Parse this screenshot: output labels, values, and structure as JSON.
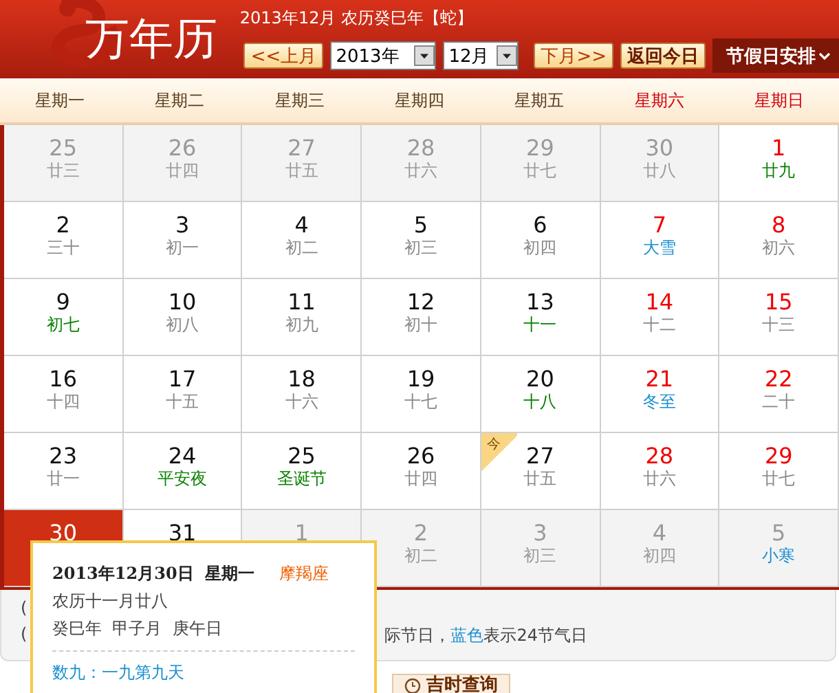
{
  "header": {
    "title": "万年历",
    "subtitle": "2013年12月 农历癸巳年【蛇】",
    "prev_button": "<<上月",
    "year_select": "2013年",
    "month_select": "12月",
    "next_button": "下月>>",
    "today_button": "返回今日",
    "holiday_menu": "节假日安排"
  },
  "weekdays": [
    {
      "label": "星期一",
      "weekend": false
    },
    {
      "label": "星期二",
      "weekend": false
    },
    {
      "label": "星期三",
      "weekend": false
    },
    {
      "label": "星期四",
      "weekend": false
    },
    {
      "label": "星期五",
      "weekend": false
    },
    {
      "label": "星期六",
      "weekend": true
    },
    {
      "label": "星期日",
      "weekend": true
    }
  ],
  "days": [
    {
      "day": "25",
      "sub": "廿三",
      "kind": "other",
      "color": "#999999",
      "selected": false
    },
    {
      "day": "26",
      "sub": "廿四",
      "kind": "other",
      "color": "#999999",
      "selected": false
    },
    {
      "day": "27",
      "sub": "廿五",
      "kind": "other",
      "color": "#999999",
      "selected": false
    },
    {
      "day": "28",
      "sub": "廿六",
      "kind": "other",
      "color": "#999999",
      "selected": false
    },
    {
      "day": "29",
      "sub": "廿七",
      "kind": "other",
      "color": "#999999",
      "selected": false
    },
    {
      "day": "30",
      "sub": "廿八",
      "kind": "other",
      "color": "#999999",
      "selected": false
    },
    {
      "day": "1",
      "sub": "廿九",
      "kind": "current",
      "color": "#098000",
      "weekend": true,
      "selected": false
    },
    {
      "day": "2",
      "sub": "三十",
      "kind": "current",
      "color": "#888888",
      "weekend": false,
      "selected": false
    },
    {
      "day": "3",
      "sub": "初一",
      "kind": "current",
      "color": "#888888",
      "weekend": false,
      "selected": false
    },
    {
      "day": "4",
      "sub": "初二",
      "kind": "current",
      "color": "#888888",
      "weekend": false,
      "selected": false
    },
    {
      "day": "5",
      "sub": "初三",
      "kind": "current",
      "color": "#888888",
      "weekend": false,
      "selected": false
    },
    {
      "day": "6",
      "sub": "初四",
      "kind": "current",
      "color": "#888888",
      "weekend": false,
      "selected": false
    },
    {
      "day": "7",
      "sub": "大雪",
      "kind": "current",
      "color": "#1a8fd0",
      "weekend": true,
      "selected": false
    },
    {
      "day": "8",
      "sub": "初六",
      "kind": "current",
      "color": "#888888",
      "weekend": true,
      "selected": false
    },
    {
      "day": "9",
      "sub": "初七",
      "kind": "current",
      "color": "#098000",
      "weekend": false,
      "selected": false
    },
    {
      "day": "10",
      "sub": "初八",
      "kind": "current",
      "color": "#888888",
      "weekend": false,
      "selected": false
    },
    {
      "day": "11",
      "sub": "初九",
      "kind": "current",
      "color": "#888888",
      "weekend": false,
      "selected": false
    },
    {
      "day": "12",
      "sub": "初十",
      "kind": "current",
      "color": "#888888",
      "weekend": false,
      "selected": false
    },
    {
      "day": "13",
      "sub": "十一",
      "kind": "current",
      "color": "#098000",
      "weekend": false,
      "selected": false
    },
    {
      "day": "14",
      "sub": "十二",
      "kind": "current",
      "color": "#888888",
      "weekend": true,
      "selected": false
    },
    {
      "day": "15",
      "sub": "十三",
      "kind": "current",
      "color": "#888888",
      "weekend": true,
      "selected": false
    },
    {
      "day": "16",
      "sub": "十四",
      "kind": "current",
      "color": "#888888",
      "weekend": false,
      "selected": false
    },
    {
      "day": "17",
      "sub": "十五",
      "kind": "current",
      "color": "#888888",
      "weekend": false,
      "selected": false
    },
    {
      "day": "18",
      "sub": "十六",
      "kind": "current",
      "color": "#888888",
      "weekend": false,
      "selected": false
    },
    {
      "day": "19",
      "sub": "十七",
      "kind": "current",
      "color": "#888888",
      "weekend": false,
      "selected": false
    },
    {
      "day": "20",
      "sub": "十八",
      "kind": "current",
      "color": "#098000",
      "weekend": false,
      "selected": false
    },
    {
      "day": "21",
      "sub": "冬至",
      "kind": "current",
      "color": "#1a8fd0",
      "weekend": true,
      "selected": false
    },
    {
      "day": "22",
      "sub": "二十",
      "kind": "current",
      "color": "#888888",
      "weekend": true,
      "selected": false
    },
    {
      "day": "23",
      "sub": "廿一",
      "kind": "current",
      "color": "#888888",
      "weekend": false,
      "selected": false
    },
    {
      "day": "24",
      "sub": "平安夜",
      "kind": "current",
      "color": "#098000",
      "weekend": false,
      "selected": false
    },
    {
      "day": "25",
      "sub": "圣诞节",
      "kind": "current",
      "color": "#098000",
      "weekend": false,
      "selected": false
    },
    {
      "day": "26",
      "sub": "廿四",
      "kind": "current",
      "color": "#888888",
      "weekend": false,
      "selected": false
    },
    {
      "day": "27",
      "sub": "廿五",
      "kind": "current",
      "color": "#888888",
      "weekend": false,
      "selected": false,
      "today_badge": "今"
    },
    {
      "day": "28",
      "sub": "廿六",
      "kind": "current",
      "color": "#888888",
      "weekend": true,
      "selected": false
    },
    {
      "day": "29",
      "sub": "廿七",
      "kind": "current",
      "color": "#888888",
      "weekend": true,
      "selected": false
    },
    {
      "day": "30",
      "kind": "current",
      "selected": true
    },
    {
      "day": "31",
      "kind": "current",
      "weekend": false,
      "selected": false
    },
    {
      "day": "1",
      "kind": "other",
      "selected": false
    },
    {
      "day": "2",
      "sub": "初二",
      "kind": "other",
      "color": "#999999",
      "selected": false
    },
    {
      "day": "3",
      "sub": "初三",
      "kind": "other",
      "color": "#999999",
      "selected": false
    },
    {
      "day": "4",
      "sub": "初四",
      "kind": "other",
      "color": "#999999",
      "selected": false
    },
    {
      "day": "5",
      "sub": "小寒",
      "kind": "other",
      "color": "#1a8fd0",
      "selected": false
    }
  ],
  "legend": [
    {
      "prefix": "("
    },
    {
      "prefix": "(",
      "segments": [
        {
          "text": "际节日，",
          "kind": "plain"
        },
        {
          "text": "蓝色",
          "kind": "blue"
        },
        {
          "text": "表示24节气日",
          "kind": "plain"
        }
      ]
    }
  ],
  "bottom_tabs": [
    {
      "label": "吉时查询"
    }
  ],
  "popup": {
    "date": "2013年12月30日",
    "weekday": "星期一",
    "zodiac": "摩羯座",
    "lunar": "农历十一月廿八",
    "ganzhi": "癸巳年  甲子月  庚午日",
    "note": "数九：一九第九天"
  }
}
